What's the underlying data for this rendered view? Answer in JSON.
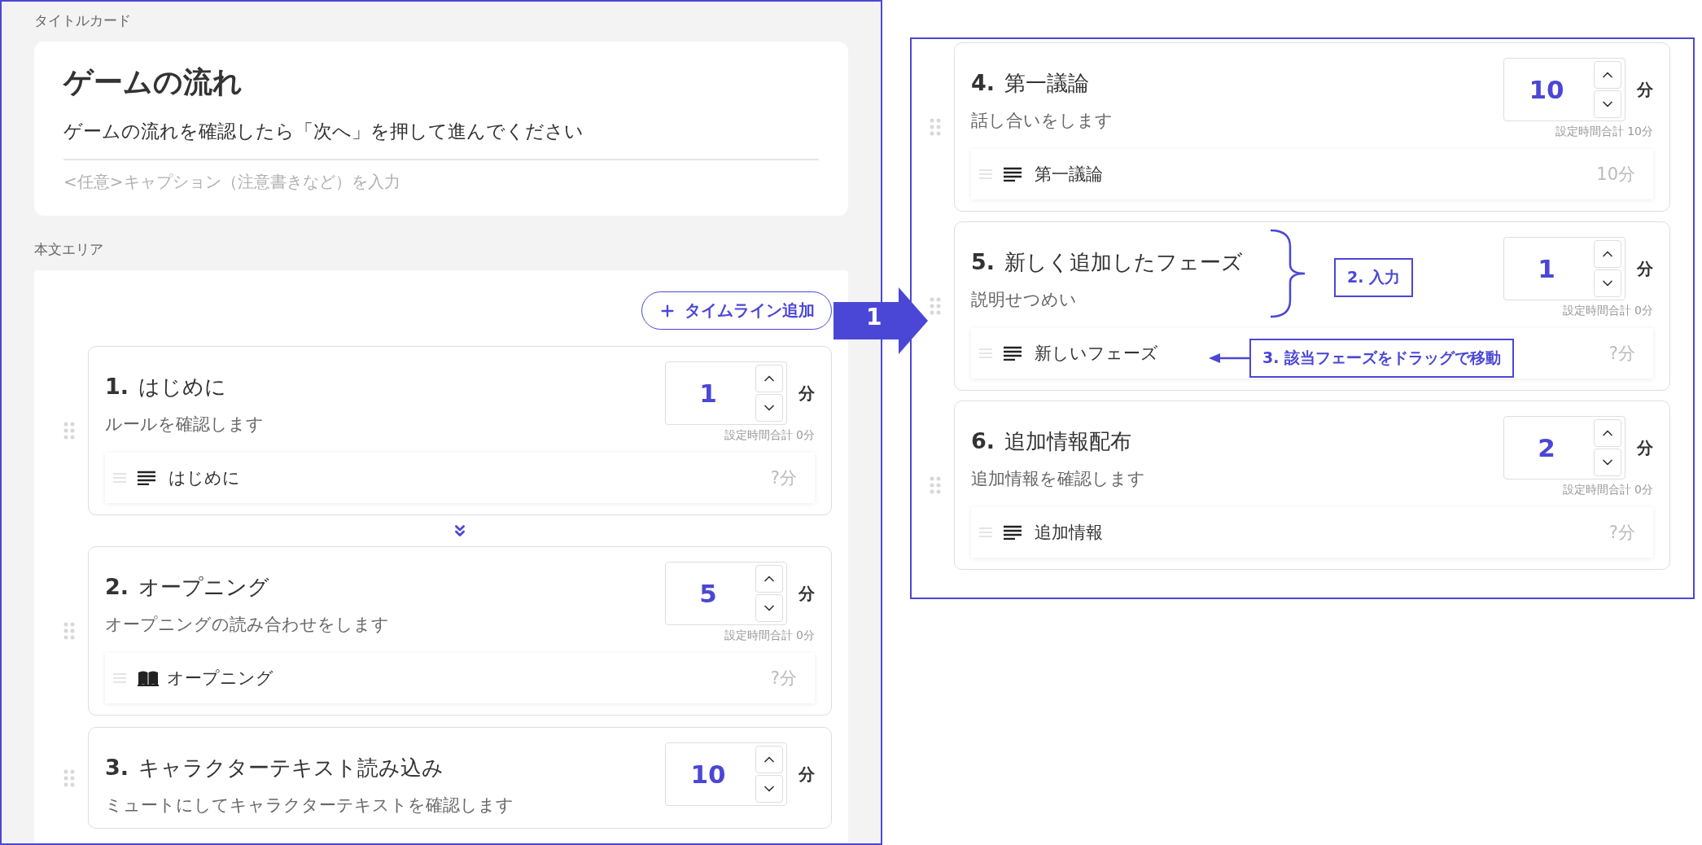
{
  "title_section": {
    "label": "タイトルカード",
    "title": "ゲームの流れ",
    "subtitle": "ゲームの流れを確認したら「次へ」を押して進んでください",
    "caption_placeholder": "<任意>キャプション（注意書きなど）を入力"
  },
  "body_section": {
    "label": "本文エリア",
    "add_button": "タイムライン追加",
    "phases": [
      {
        "number": "1.",
        "title": "はじめに",
        "description": "ルールを確認します",
        "minutes": "1",
        "unit": "分",
        "total": "設定時間合計 0分",
        "next_arrow": true,
        "items": [
          {
            "kind": "text",
            "label": "はじめに",
            "time": "?分"
          }
        ]
      },
      {
        "number": "2.",
        "title": "オープニング",
        "description": "オープニングの読み合わせをします",
        "minutes": "5",
        "unit": "分",
        "total": "設定時間合計 0分",
        "next_arrow": false,
        "items": [
          {
            "kind": "book",
            "label": "オープニング",
            "time": "?分"
          }
        ]
      },
      {
        "number": "3.",
        "title": "キャラクターテキスト読み込み",
        "description": "ミュートにしてキャラクターテキストを確認します",
        "minutes": "10",
        "unit": "分",
        "next_arrow": false
      }
    ]
  },
  "step_arrow": {
    "text": "1"
  },
  "detail_panel": {
    "phases": [
      {
        "number": "4.",
        "title": "第一議論",
        "description": "話し合いをします",
        "minutes": "10",
        "unit": "分",
        "total": "設定時間合計 10分",
        "items": [
          {
            "kind": "text",
            "label": "第一議論",
            "time": "10分"
          }
        ]
      },
      {
        "number": "5.",
        "title": "新しく追加したフェーズ",
        "description": "説明せつめい",
        "minutes": "1",
        "unit": "分",
        "total": "設定時間合計 0分",
        "items": [
          {
            "kind": "text",
            "label": "新しいフェーズ",
            "time": "?分"
          }
        ],
        "annotations": [
          {
            "kind": "brace",
            "text": "2. 入力"
          },
          {
            "kind": "arrow",
            "text": "3. 該当フェーズをドラッグで移動"
          }
        ]
      },
      {
        "number": "6.",
        "title": "追加情報配布",
        "description": "追加情報を確認します",
        "minutes": "2",
        "unit": "分",
        "total": "設定時間合計 0分",
        "items": [
          {
            "kind": "text",
            "label": "追加情報",
            "time": "?分"
          }
        ]
      }
    ]
  }
}
